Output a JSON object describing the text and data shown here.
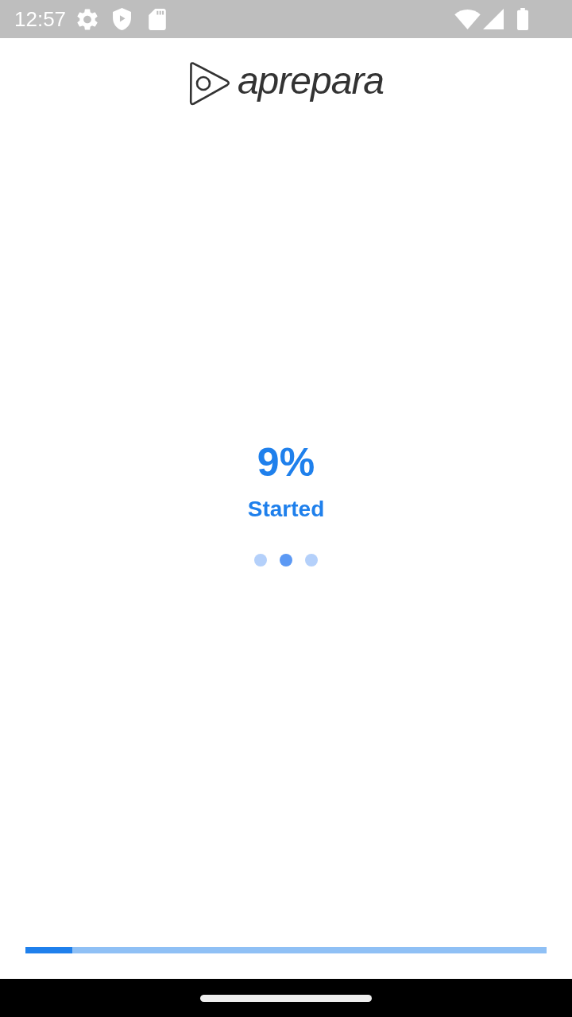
{
  "status_bar": {
    "time": "12:57"
  },
  "logo": {
    "text": "aprepara"
  },
  "progress": {
    "percent": "9%",
    "status": "Started",
    "level": 0.09
  },
  "loading_dots": [
    {
      "selected": false
    },
    {
      "selected": true
    },
    {
      "selected": false
    }
  ]
}
